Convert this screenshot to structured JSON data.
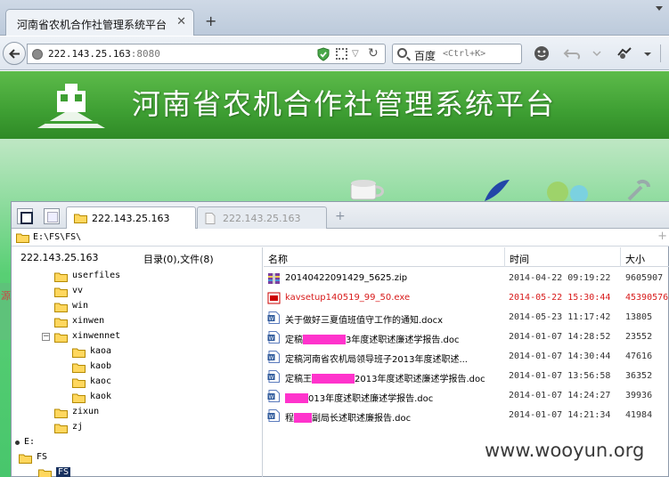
{
  "browser": {
    "tab_title": "河南省农机合作社管理系统平台",
    "close_glyph": "✕",
    "new_tab_glyph": "+",
    "url_host": "222.143.25.163",
    "url_port": ":8080",
    "search_engine": "百度",
    "search_hint": "<Ctrl+K>"
  },
  "page": {
    "banner_title": "河南省农机合作社管理系统平台",
    "side_text": "源",
    "watermark": "www.wooyun.org"
  },
  "file_manager": {
    "tabs": [
      {
        "label": "222.143.25.163",
        "active": true
      },
      {
        "label": "222.143.25.163",
        "active": false
      }
    ],
    "new_tab_glyph": "+",
    "path": "E:\\FS\\FS\\",
    "path_plus": "+",
    "host": "222.143.25.163",
    "counts": "目录(0),文件(8)",
    "tree": [
      {
        "label": "userfiles",
        "expander": ""
      },
      {
        "label": "vv",
        "expander": ""
      },
      {
        "label": "win",
        "expander": ""
      },
      {
        "label": "xinwen",
        "expander": ""
      },
      {
        "label": "xinwennet",
        "expander": "−"
      },
      {
        "label": "kaoa",
        "expander": ""
      },
      {
        "label": "kaob",
        "expander": ""
      },
      {
        "label": "kaoc",
        "expander": ""
      },
      {
        "label": "kaok",
        "expander": ""
      },
      {
        "label": "zixun",
        "expander": ""
      },
      {
        "label": "zj",
        "expander": ""
      },
      {
        "label": "E:",
        "expander": ""
      },
      {
        "label": "FS",
        "expander": ""
      },
      {
        "label": "FS",
        "expander": ""
      }
    ],
    "columns": {
      "name": "名称",
      "time": "时间",
      "size": "大小"
    },
    "files": [
      {
        "type": "zip",
        "name": "20140422091429_5625.zip",
        "time": "2014-04-22 09:19:22",
        "size": "9605907",
        "highlight": false
      },
      {
        "type": "exe",
        "name": "kavsetup140519_99_50.exe",
        "time": "2014-05-22 15:30:44",
        "size": "45390576",
        "highlight": true
      },
      {
        "type": "doc",
        "name": "关于做好三夏值班值守工作的通知.docx",
        "time": "2014-05-23 11:17:42",
        "size": "13805",
        "highlight": false
      },
      {
        "type": "doc",
        "name_pre": "定稿",
        "name_post": "3年度述职述廉述学报告.doc",
        "time": "2014-01-07 14:28:52",
        "size": "23552",
        "highlight": false
      },
      {
        "type": "doc",
        "name": "定稿河南省农机局领导班子2013年度述职述...",
        "time": "2014-01-07 14:30:44",
        "size": "47616",
        "highlight": false
      },
      {
        "type": "doc",
        "name_pre": "定稿王",
        "name_post": "2013年度述职述廉述学报告.doc",
        "time": "2014-01-07 13:56:58",
        "size": "36352",
        "highlight": false
      },
      {
        "type": "doc",
        "name_pre": "",
        "name_post": "013年度述职述廉述学报告.doc",
        "time": "2014-01-07 14:24:27",
        "size": "39936",
        "highlight": false
      },
      {
        "type": "doc",
        "name_pre": "程",
        "name_post": "副局长述职述廉报告.doc",
        "time": "2014-01-07 14:21:34",
        "size": "41984",
        "highlight": false
      }
    ]
  },
  "colors": {
    "banner_green": "#3e9f33",
    "highlight_red": "#d81b1b",
    "redaction": "#ff33cc",
    "selection_navy": "#17315f"
  }
}
